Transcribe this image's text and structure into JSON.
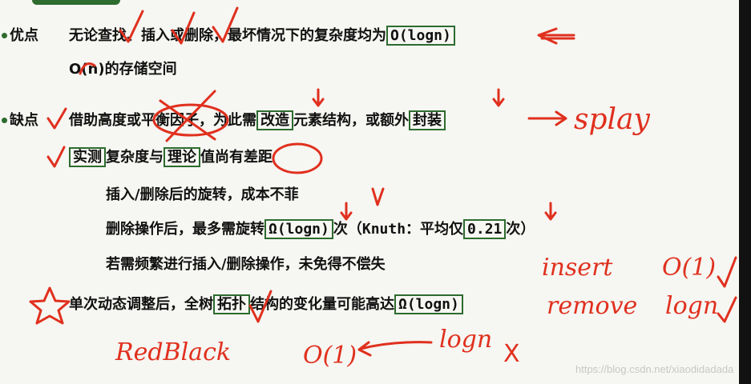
{
  "slide": {
    "pros_label": "优点",
    "pros_line1": "无论查找、插入或删除，最坏情况下的复杂度均为",
    "pros_line1_box": "O(logn)",
    "pros_line2": "O(n)的存储空间",
    "cons_label": "缺点",
    "cons_line1_a": "借助高度或",
    "cons_line1_b": "平衡因子",
    "cons_line1_c": "，为此需",
    "cons_line1_box1": "改造",
    "cons_line1_d": "元素结构，或额外",
    "cons_line1_box2": "封装",
    "cons_line2_box1": "实测",
    "cons_line2_a": "复杂度与",
    "cons_line2_box2": "理论",
    "cons_line2_b": "值尚有差距",
    "sub1": "插入/删除后的旋转，成本不菲",
    "sub2_a": "删除操作后，最多需旋转",
    "sub2_box1": "Ω(logn)",
    "sub2_b": "次（",
    "sub2_knuth": "Knuth",
    "sub2_c": "：平均仅",
    "sub2_box2": "0.21",
    "sub2_d": "次）",
    "sub3": "若需频繁进行插入/删除操作，未免得不偿失",
    "last_a": "单次动态调整后，全树",
    "last_box1": "拓扑",
    "last_b": "结构的变化量可能高达",
    "last_box2": "Ω(logn)"
  },
  "annotations": {
    "splay": "splay",
    "insert": "insert",
    "remove": "remove",
    "o1_top": "O(1)",
    "logn_right": "logn",
    "redblack": "RedBlack",
    "o1_bottom": "O(1)",
    "logn_bottom": "logn",
    "x_mark": "X"
  },
  "watermark": "https://blog.csdn.net/xiaodidadada",
  "colors": {
    "ink": "#e0301e",
    "box": "#2d6b2f",
    "background": "#f6f6f2"
  }
}
